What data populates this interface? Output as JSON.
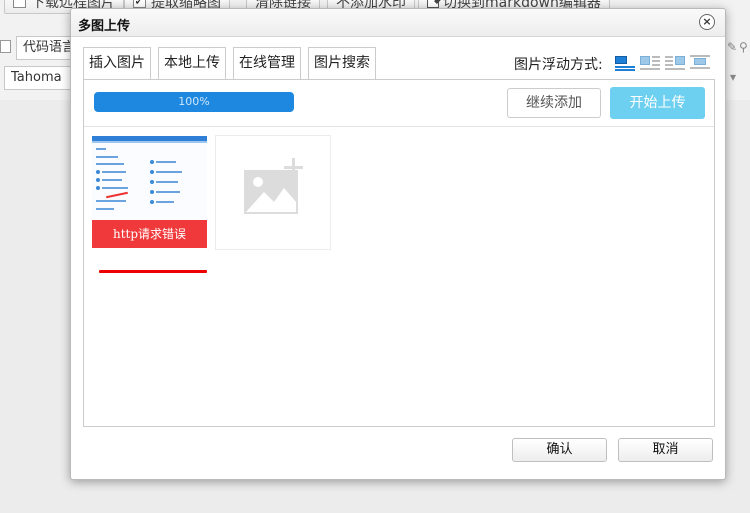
{
  "background_toolbar": {
    "download_remote_label": "下载远程图片",
    "extract_thumbnail_label": "提取缩略图",
    "clear_links_label": "清除链接",
    "no_watermark_label": "不添加水印",
    "switch_markdown_label": "切换到markdown编辑器",
    "code_language_label": "代码语言",
    "font_name": "Tahoma"
  },
  "dialog": {
    "title": "多图上传",
    "close_symbol": "×",
    "tabs": [
      "插入图片",
      "本地上传",
      "在线管理",
      "图片搜索"
    ],
    "active_tab": "本地上传",
    "float_label": "图片浮动方式:",
    "float_options": [
      "none-icon",
      "left-icon",
      "right-icon",
      "center-icon"
    ],
    "progress_text": "100%",
    "progress_value": 1.0,
    "continue_add_label": "继续添加",
    "start_upload_label": "开始上传",
    "upload_error_text": "http请求错误",
    "ok_label": "确认",
    "cancel_label": "取消"
  },
  "colors": {
    "progress": "#1e88e0",
    "start_button": "#6dd0f0",
    "error_banner": "#f0393a",
    "error_line": "#e00000"
  }
}
